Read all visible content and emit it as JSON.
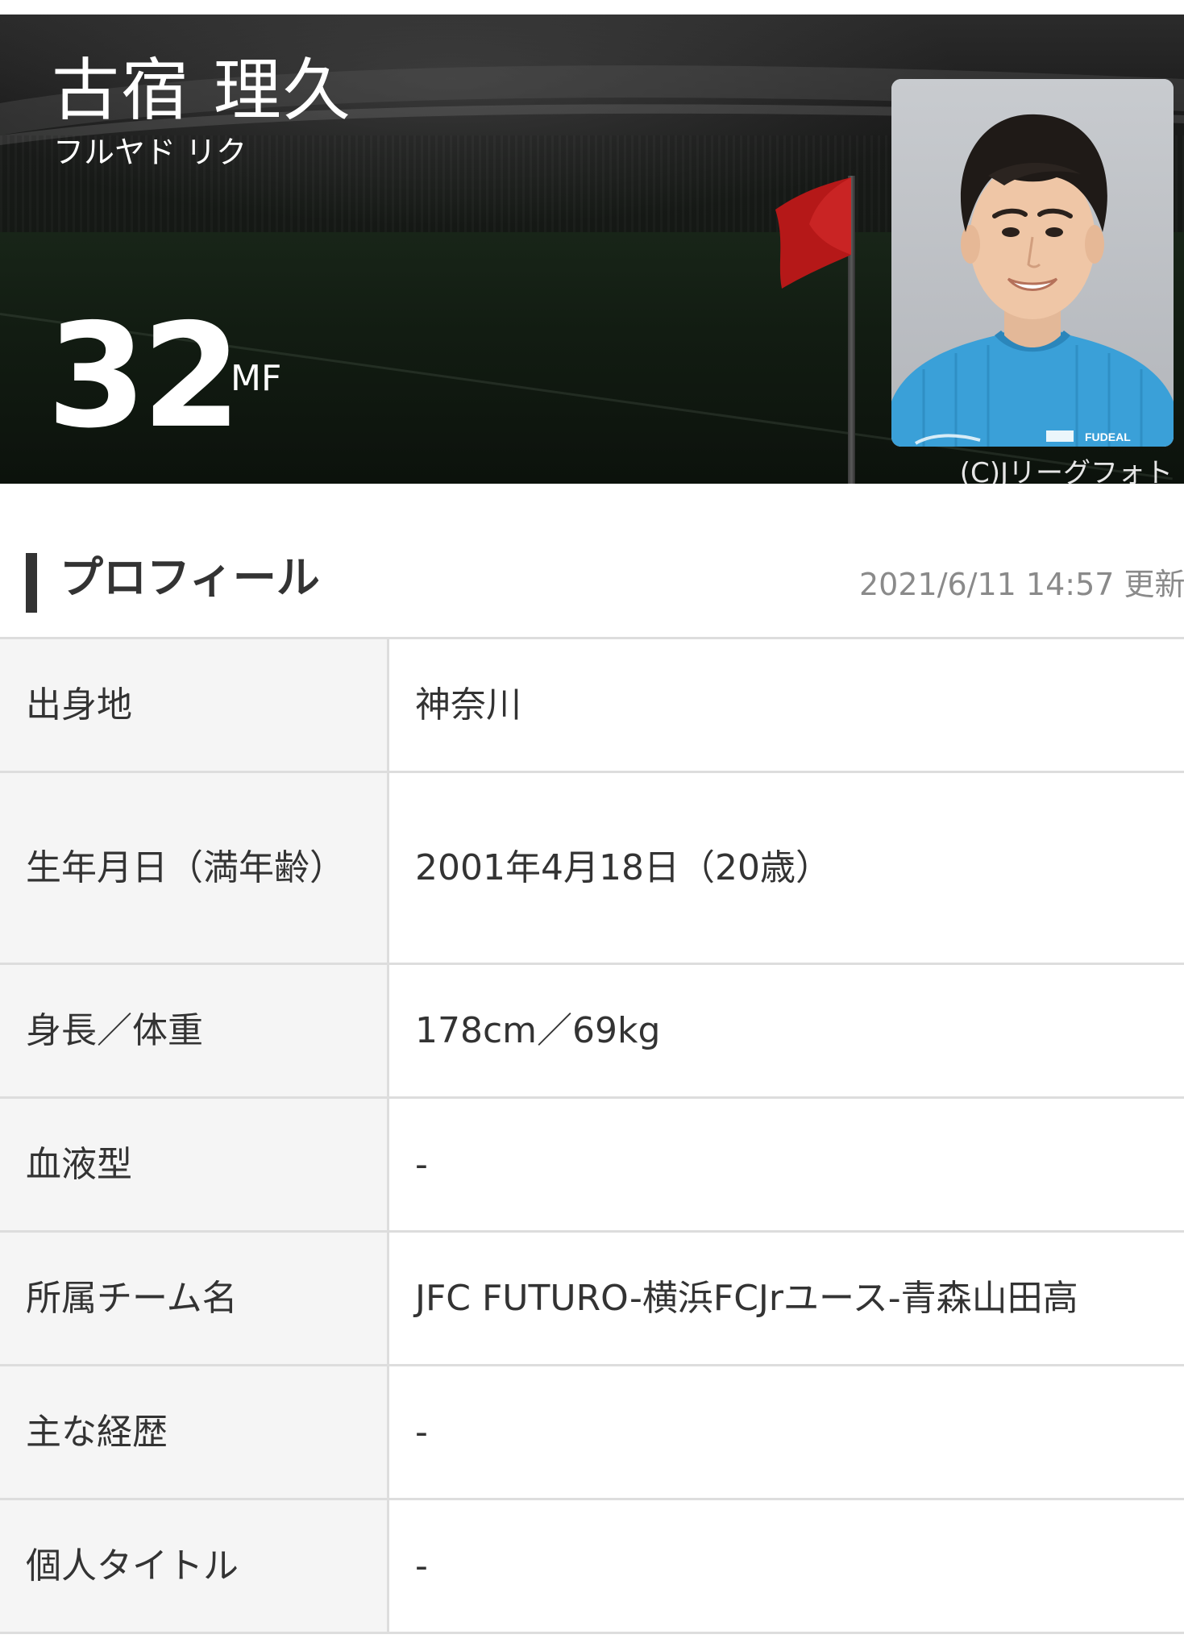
{
  "hero": {
    "name": "古宿 理久",
    "kana": "フルヤド リク",
    "number": "32",
    "position": "MF",
    "photo_credit": "(C)Jリーグフォト",
    "portrait_jersey_text": "FUDEAL"
  },
  "section": {
    "title": "プロフィール",
    "updated": "2021/6/11 14:57 更新"
  },
  "profile": [
    {
      "label": "出身地",
      "value": "神奈川"
    },
    {
      "label": "生年月日（満年齢）",
      "value": "2001年4月18日（20歳）"
    },
    {
      "label": "身長／体重",
      "value": "178cm／69kg"
    },
    {
      "label": "血液型",
      "value": "-"
    },
    {
      "label": "所属チーム名",
      "value": "JFC FUTURO-横浜FCJrユース-青森山田高"
    },
    {
      "label": "主な経歴",
      "value": "-"
    },
    {
      "label": "個人タイトル",
      "value": "-"
    }
  ],
  "colors": {
    "hero_bg": "#151915",
    "jersey": "#3aa0d8",
    "text_dark": "#333333",
    "label_bg": "#f5f5f5",
    "border": "#dddddd",
    "flag": "#c41a1a"
  }
}
